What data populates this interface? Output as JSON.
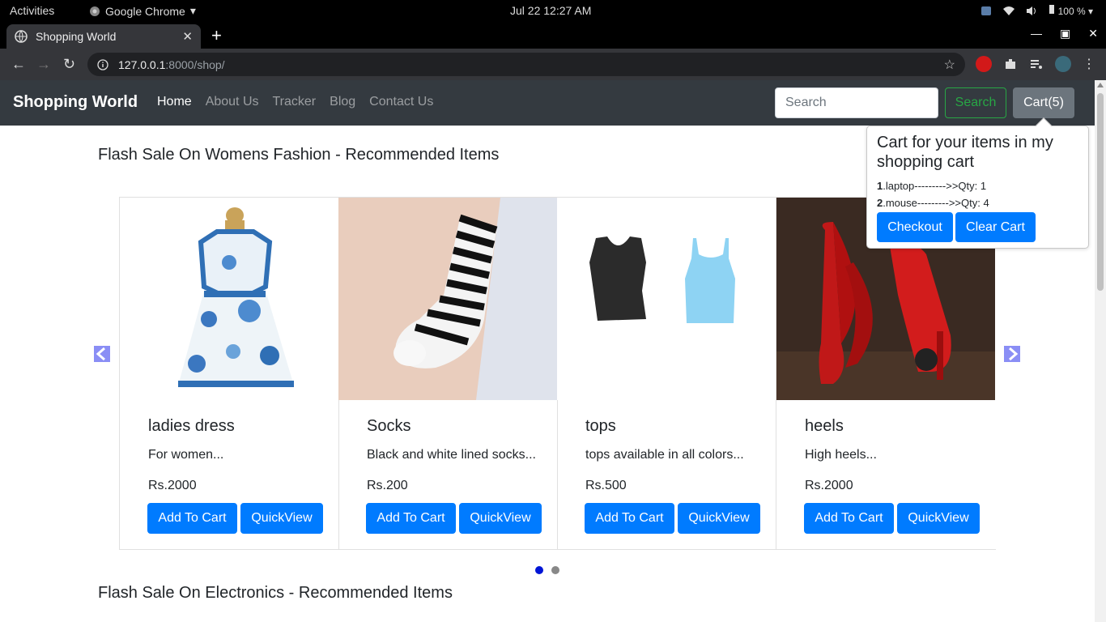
{
  "system": {
    "activities": "Activities",
    "app_name": "Google Chrome",
    "clock": "Jul 22  12:27 AM",
    "battery": "100 %"
  },
  "browser": {
    "tab_title": "Shopping World",
    "tab_close": "✕",
    "new_tab": "+",
    "url_host": "127.0.0.1",
    "url_path": ":8000/shop/"
  },
  "navbar": {
    "brand": "Shopping World",
    "links": [
      "Home",
      "About Us",
      "Tracker",
      "Blog",
      "Contact Us"
    ],
    "search_placeholder": "Search",
    "search_button": "Search",
    "cart_button": "Cart(5)"
  },
  "cart_popover": {
    "title": "Cart for your items in my shopping cart",
    "items": [
      {
        "num": "1",
        "text": ".laptop--------->>Qty: 1"
      },
      {
        "num": "2",
        "text": ".mouse--------->>Qty: 4"
      }
    ],
    "checkout": "Checkout",
    "clear": "Clear Cart"
  },
  "sections": {
    "womens_title": "Flash Sale On Womens Fashion - Recommended Items",
    "electronics_title": "Flash Sale On Electronics - Recommended Items"
  },
  "products": [
    {
      "title": "ladies dress",
      "desc": "For women...",
      "price": "Rs.2000",
      "add": "Add To Cart",
      "quick": "QuickView"
    },
    {
      "title": "Socks",
      "desc": "Black and white lined socks...",
      "price": "Rs.200",
      "add": "Add To Cart",
      "quick": "QuickView"
    },
    {
      "title": "tops",
      "desc": "tops available in all colors...",
      "price": "Rs.500",
      "add": "Add To Cart",
      "quick": "QuickView"
    },
    {
      "title": "heels",
      "desc": "High heels...",
      "price": "Rs.2000",
      "add": "Add To Cart",
      "quick": "QuickView"
    }
  ],
  "carousel": {
    "active_slide": 1,
    "slide_count": 2
  },
  "colors": {
    "navbar_bg": "#343a40",
    "primary": "#007bff",
    "success": "#28a745",
    "secondary": "#6c757d"
  }
}
